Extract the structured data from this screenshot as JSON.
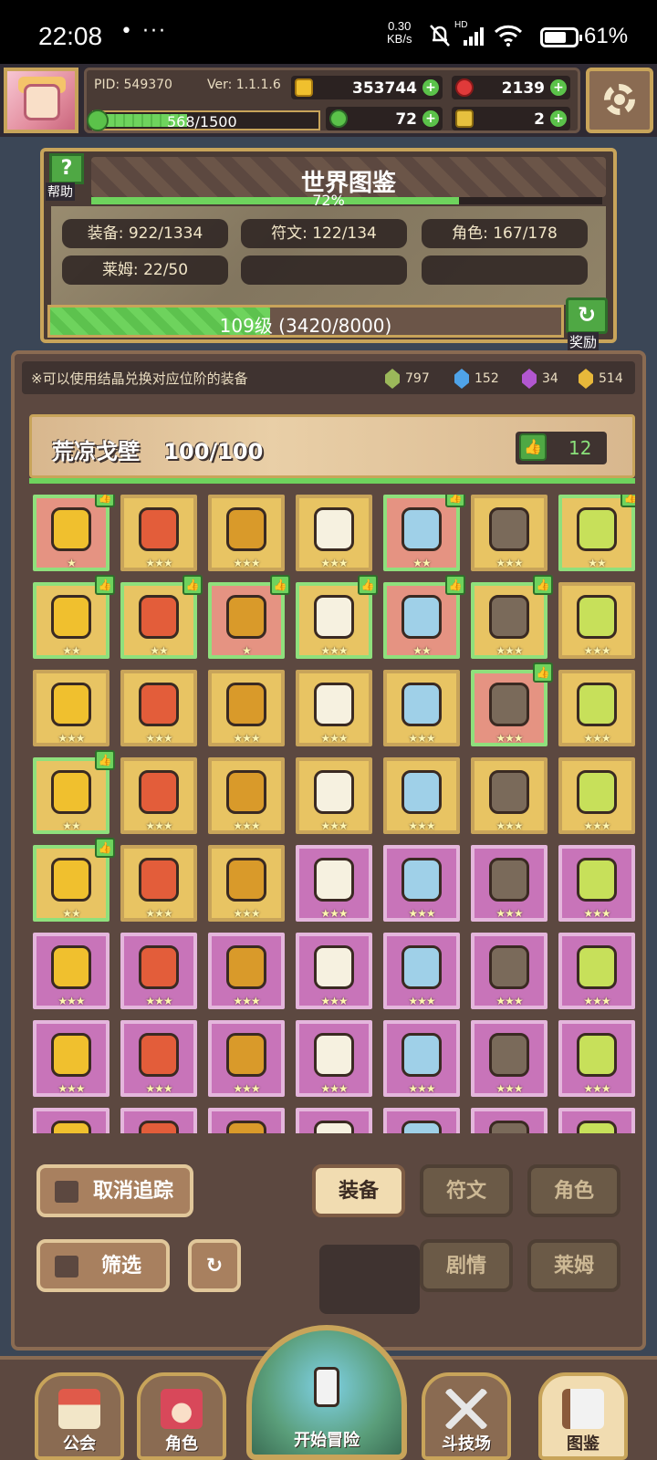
{
  "status_bar": {
    "time": "22:08",
    "dots": "•  ···",
    "net_speed": "0.30",
    "net_unit": "KB/s",
    "signal_label": "HD",
    "battery_percent": "61%"
  },
  "header": {
    "pid": "PID: 549370",
    "version": "Ver: 1.1.1.6",
    "gold": "353744",
    "gems": "2139",
    "clover": "72",
    "keys": "2",
    "stamina": "568/1500",
    "stamina_fraction": 0.38
  },
  "world_compendium": {
    "title": "世界图鉴",
    "help_label": "帮助",
    "progress_percent": "72%",
    "progress_fraction": 0.72,
    "stats": {
      "equipment": "装备: 922/1334",
      "runes": "符文: 122/134",
      "characters": "角色: 167/178",
      "slimes": "莱姆: 22/50"
    },
    "level": "109级 (3420/8000)",
    "level_fraction": 0.43,
    "reward_label": "奖励"
  },
  "collection": {
    "hint": "※可以使用结晶兑换对应位阶的装备",
    "crystals": [
      {
        "icon": "green-crystal-icon",
        "count": "797",
        "color": "#9bb85a"
      },
      {
        "icon": "blue-crystal-icon",
        "count": "152",
        "color": "#4fa3e8"
      },
      {
        "icon": "purple-crystal-icon",
        "count": "34",
        "color": "#b257d0"
      },
      {
        "icon": "gold-crystal-icon",
        "count": "514",
        "color": "#e8b83a"
      }
    ],
    "region_name": "荒凉戈壁",
    "region_progress": "100/100",
    "likes": "12",
    "rows": [
      [
        {
          "c": "red",
          "s": "★",
          "t": 1
        },
        {
          "c": "gold",
          "s": "★★★",
          "t": 0
        },
        {
          "c": "gold",
          "s": "★★★",
          "t": 0
        },
        {
          "c": "gold",
          "s": "★★★",
          "t": 0
        },
        {
          "c": "red",
          "s": "★★",
          "t": 1
        },
        {
          "c": "gold",
          "s": "★★★",
          "t": 0
        },
        {
          "c": "gold",
          "s": "★★",
          "t": 1
        }
      ],
      [
        {
          "c": "gold",
          "s": "★★",
          "t": 1
        },
        {
          "c": "gold",
          "s": "★★",
          "t": 1
        },
        {
          "c": "red",
          "s": "★",
          "t": 1
        },
        {
          "c": "gold",
          "s": "★★★",
          "t": 1
        },
        {
          "c": "red",
          "s": "★★",
          "t": 1
        },
        {
          "c": "gold",
          "s": "★★★",
          "t": 1
        },
        {
          "c": "gold",
          "s": "★★★",
          "t": 0
        }
      ],
      [
        {
          "c": "gold",
          "s": "★★★",
          "t": 0
        },
        {
          "c": "gold",
          "s": "★★★",
          "t": 0
        },
        {
          "c": "gold",
          "s": "★★★",
          "t": 0
        },
        {
          "c": "gold",
          "s": "★★★",
          "t": 0
        },
        {
          "c": "gold",
          "s": "★★★",
          "t": 0
        },
        {
          "c": "red",
          "s": "★★★",
          "t": 1
        },
        {
          "c": "gold",
          "s": "★★★",
          "t": 0
        }
      ],
      [
        {
          "c": "gold",
          "s": "★★",
          "t": 1
        },
        {
          "c": "gold",
          "s": "★★★",
          "t": 0
        },
        {
          "c": "gold",
          "s": "★★★",
          "t": 0
        },
        {
          "c": "gold",
          "s": "★★★",
          "t": 0
        },
        {
          "c": "gold",
          "s": "★★★",
          "t": 0
        },
        {
          "c": "gold",
          "s": "★★★",
          "t": 0
        },
        {
          "c": "gold",
          "s": "★★★",
          "t": 0
        }
      ],
      [
        {
          "c": "gold",
          "s": "★★",
          "t": 1
        },
        {
          "c": "gold",
          "s": "★★★",
          "t": 0
        },
        {
          "c": "gold",
          "s": "★★★",
          "t": 0
        },
        {
          "c": "purple",
          "s": "★★★",
          "t": 0
        },
        {
          "c": "purple",
          "s": "★★★",
          "t": 0
        },
        {
          "c": "purple",
          "s": "★★★",
          "t": 0
        },
        {
          "c": "purple",
          "s": "★★★",
          "t": 0
        }
      ],
      [
        {
          "c": "purple",
          "s": "★★★",
          "t": 0
        },
        {
          "c": "purple",
          "s": "★★★",
          "t": 0
        },
        {
          "c": "purple",
          "s": "★★★",
          "t": 0
        },
        {
          "c": "purple",
          "s": "★★★",
          "t": 0
        },
        {
          "c": "purple",
          "s": "★★★",
          "t": 0
        },
        {
          "c": "purple",
          "s": "★★★",
          "t": 0
        },
        {
          "c": "purple",
          "s": "★★★",
          "t": 0
        }
      ],
      [
        {
          "c": "purple",
          "s": "★★★",
          "t": 0
        },
        {
          "c": "purple",
          "s": "★★★",
          "t": 0
        },
        {
          "c": "purple",
          "s": "★★★",
          "t": 0
        },
        {
          "c": "purple",
          "s": "★★★",
          "t": 0
        },
        {
          "c": "purple",
          "s": "★★★",
          "t": 0
        },
        {
          "c": "purple",
          "s": "★★★",
          "t": 0
        },
        {
          "c": "purple",
          "s": "★★★",
          "t": 0
        }
      ],
      [
        {
          "c": "purple",
          "s": "",
          "t": 0
        },
        {
          "c": "purple",
          "s": "",
          "t": 0
        },
        {
          "c": "purple",
          "s": "",
          "t": 0
        },
        {
          "c": "purple",
          "s": "",
          "t": 0
        },
        {
          "c": "purple",
          "s": "",
          "t": 0
        },
        {
          "c": "purple",
          "s": "",
          "t": 0
        },
        {
          "c": "purple",
          "s": "",
          "t": 0
        }
      ]
    ],
    "item_palettes": [
      "#f0c02e",
      "#e35d3a",
      "#d99a2a",
      "#f6f1e0",
      "#9fd0e8",
      "#7a6a5a",
      "#c7e05a"
    ]
  },
  "controls": {
    "untrack": "取消追踪",
    "filter": "筛选",
    "tabs": {
      "equipment": "装备",
      "runes": "符文",
      "characters": "角色",
      "story": "剧情",
      "slimes": "莱姆"
    }
  },
  "nav": {
    "guild": "公会",
    "character": "角色",
    "start": "开始冒险",
    "arena": "斗技场",
    "compendium": "图鉴"
  }
}
